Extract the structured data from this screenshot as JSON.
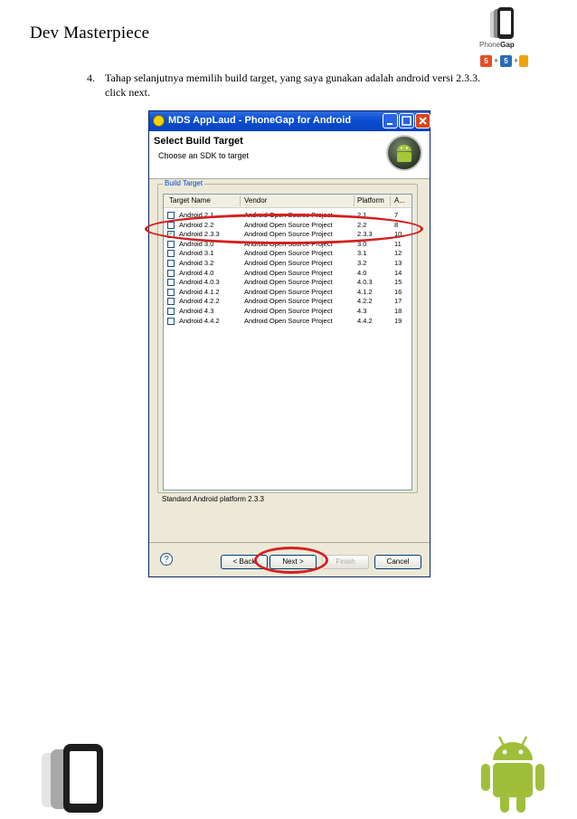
{
  "header": {
    "title": "Dev Masterpiece",
    "logo_label_plain": "Phone",
    "logo_label_bold": "Gap",
    "badge": "5"
  },
  "step": {
    "number": "4.",
    "text": "Tahap selanjutnya memilih build target, yang saya gunakan adalah android versi 2.3.3. click next."
  },
  "dialog": {
    "title": "MDS AppLaud - PhoneGap for Android",
    "heading": "Select Build Target",
    "subheading": "Choose an SDK to target",
    "group_label": "Build Target",
    "columns": [
      "Target Name",
      "Vendor",
      "Platform",
      "A..."
    ],
    "rows": [
      {
        "name": "Android 2.1",
        "vendor": "Android Open Source Project",
        "platform": "2.1",
        "api": "7",
        "checked": false
      },
      {
        "name": "Android 2.2",
        "vendor": "Android Open Source Project",
        "platform": "2.2",
        "api": "8",
        "checked": false
      },
      {
        "name": "Android 2.3.3",
        "vendor": "Android Open Source Project",
        "platform": "2.3.3",
        "api": "10",
        "checked": true
      },
      {
        "name": "Android 3.0",
        "vendor": "Android Open Source Project",
        "platform": "3.0",
        "api": "11",
        "checked": false
      },
      {
        "name": "Android 3.1",
        "vendor": "Android Open Source Project",
        "platform": "3.1",
        "api": "12",
        "checked": false
      },
      {
        "name": "Android 3.2",
        "vendor": "Android Open Source Project",
        "platform": "3.2",
        "api": "13",
        "checked": false
      },
      {
        "name": "Android 4.0",
        "vendor": "Android Open Source Project",
        "platform": "4.0",
        "api": "14",
        "checked": false
      },
      {
        "name": "Android 4.0.3",
        "vendor": "Android Open Source Project",
        "platform": "4.0.3",
        "api": "15",
        "checked": false
      },
      {
        "name": "Android 4.1.2",
        "vendor": "Android Open Source Project",
        "platform": "4.1.2",
        "api": "16",
        "checked": false
      },
      {
        "name": "Android 4.2.2",
        "vendor": "Android Open Source Project",
        "platform": "4.2.2",
        "api": "17",
        "checked": false
      },
      {
        "name": "Android 4.3",
        "vendor": "Android Open Source Project",
        "platform": "4.3",
        "api": "18",
        "checked": false
      },
      {
        "name": "Android 4.4.2",
        "vendor": "Android Open Source Project",
        "platform": "4.4.2",
        "api": "19",
        "checked": false
      }
    ],
    "status_text": "Standard Android platform 2.3.3",
    "help_label": "?",
    "buttons": {
      "back": "< Back",
      "next": "Next >",
      "finish": "Finish",
      "cancel": "Cancel"
    }
  },
  "colors": {
    "highlight_circle": "#d42020",
    "titlebar": "#0a4ed0",
    "android_green": "#9fbf3b"
  }
}
